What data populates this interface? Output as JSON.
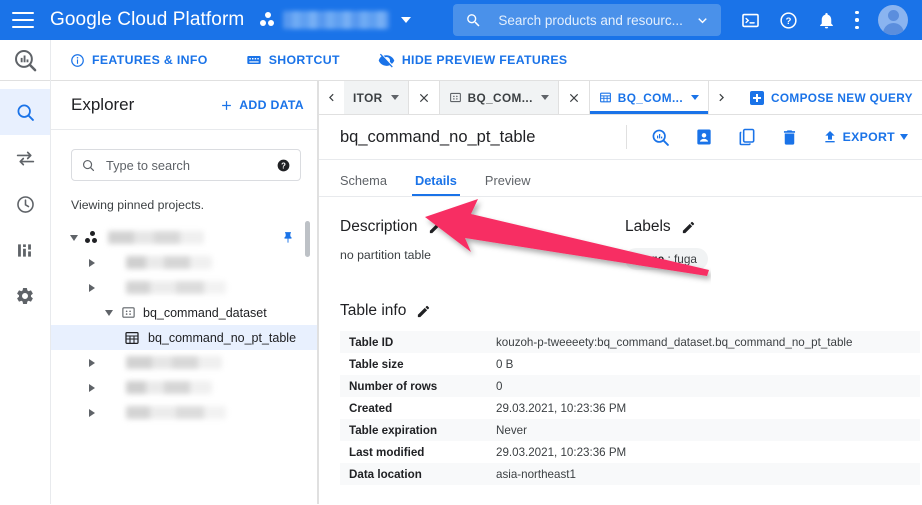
{
  "topbar": {
    "menu_icon": "hamburger-icon",
    "brand": "Google Cloud Platform",
    "project_icon": "project-dots-icon",
    "project_name_redacted": "",
    "search": {
      "icon": "search-icon",
      "placeholder": "Search products and resourc...",
      "dropdown_icon": "chevron-down-icon"
    },
    "actions": [
      {
        "name": "cloud-shell-icon",
        "label": ""
      },
      {
        "name": "help-icon",
        "label": ""
      },
      {
        "name": "notifications-icon",
        "label": ""
      },
      {
        "name": "more-options-icon",
        "label": ""
      },
      {
        "name": "avatar",
        "label": ""
      }
    ]
  },
  "featurebar": {
    "product_logo": "bigquery-logo-icon",
    "items": [
      {
        "icon": "info-icon",
        "label": "FEATURES & INFO"
      },
      {
        "icon": "keyboard-icon",
        "label": "SHORTCUT"
      },
      {
        "icon": "eye-off-icon",
        "label": "HIDE PREVIEW FEATURES"
      }
    ]
  },
  "rail": {
    "items": [
      {
        "name": "rail-search",
        "icon": "search-icon",
        "active": true
      },
      {
        "name": "rail-transfers",
        "icon": "transfer-arrows-icon",
        "active": false
      },
      {
        "name": "rail-history",
        "icon": "clock-icon",
        "active": false
      },
      {
        "name": "rail-analytics",
        "icon": "bar-chart-icon",
        "active": false
      },
      {
        "name": "rail-settings",
        "icon": "gear-icon",
        "active": false
      }
    ]
  },
  "explorer": {
    "title": "Explorer",
    "add_data": {
      "icon": "plus-icon",
      "label": "ADD DATA"
    },
    "search": {
      "icon": "search-icon",
      "placeholder": "Type to search",
      "help_icon": "help-filled-icon"
    },
    "status_text": "Viewing pinned projects.",
    "tree": [
      {
        "name": "tree-project-redacted",
        "label": "",
        "indent": 0,
        "expander": "down",
        "icon": "project-dots-icon",
        "redacted": true,
        "pinned": true,
        "pin_icon": "pin-icon"
      },
      {
        "name": "tree-dataset-redacted-1",
        "label": "",
        "indent": 1,
        "expander": "right",
        "icon": "",
        "redacted": true
      },
      {
        "name": "tree-dataset-redacted-2",
        "label": "",
        "indent": 1,
        "expander": "right",
        "icon": "",
        "redacted": true
      },
      {
        "name": "tree-dataset-bq-command-dataset",
        "label": "bq_command_dataset",
        "indent": 1,
        "expander": "down",
        "icon": "dataset-icon",
        "redacted": false
      },
      {
        "name": "tree-table-bq-command-no-pt-table",
        "label": "bq_command_no_pt_table",
        "indent": 2,
        "expander": "none",
        "icon": "table-icon",
        "redacted": false,
        "selected": true
      },
      {
        "name": "tree-dataset-redacted-3",
        "label": "",
        "indent": 1,
        "expander": "right",
        "icon": "",
        "redacted": true
      },
      {
        "name": "tree-dataset-redacted-4",
        "label": "",
        "indent": 1,
        "expander": "right",
        "icon": "",
        "redacted": true
      },
      {
        "name": "tree-dataset-redacted-5",
        "label": "",
        "indent": 1,
        "expander": "right",
        "icon": "",
        "redacted": true
      }
    ]
  },
  "tabs": {
    "prev_icon": "chevron-left-icon",
    "next_icon": "chevron-right-icon",
    "items": [
      {
        "name": "tab-editor",
        "label": "ITOR",
        "icon": "",
        "active": false,
        "closeable": true
      },
      {
        "name": "tab-dataset",
        "label": "BQ_COM...",
        "icon": "dataset-icon",
        "active": false,
        "closeable": true
      },
      {
        "name": "tab-table",
        "label": "BQ_COM...",
        "icon": "table-icon",
        "active": true,
        "closeable": false
      }
    ],
    "compose": {
      "icon": "plus-square-icon",
      "label": "COMPOSE NEW QUERY"
    }
  },
  "table_header": {
    "title": "bq_command_no_pt_table",
    "actions": [
      {
        "name": "query-table-button",
        "icon": "query-icon"
      },
      {
        "name": "share-table-button",
        "icon": "person-card-icon"
      },
      {
        "name": "copy-table-button",
        "icon": "copy-icon"
      },
      {
        "name": "delete-table-button",
        "icon": "trash-icon"
      }
    ],
    "export": {
      "icon": "upload-icon",
      "label": "EXPORT",
      "dropdown_icon": "chevron-down-icon"
    }
  },
  "subtabs": [
    {
      "name": "tab-schema",
      "label": "Schema",
      "active": false
    },
    {
      "name": "tab-details",
      "label": "Details",
      "active": true
    },
    {
      "name": "tab-preview",
      "label": "Preview",
      "active": false
    }
  ],
  "details": {
    "description": {
      "title": "Description",
      "edit_icon": "pencil-icon",
      "value": "no partition table"
    },
    "labels": {
      "title": "Labels",
      "edit_icon": "pencil-icon",
      "chip_key": "hoge",
      "chip_sep": " : ",
      "chip_value": "fuga"
    },
    "table_info": {
      "title": "Table info",
      "edit_icon": "pencil-icon",
      "rows": [
        {
          "key": "Table ID",
          "value": "kouzoh-p-tweeeety:bq_command_dataset.bq_command_no_pt_table"
        },
        {
          "key": "Table size",
          "value": "0 B"
        },
        {
          "key": "Number of rows",
          "value": "0"
        },
        {
          "key": "Created",
          "value": "29.03.2021, 10:23:36 PM"
        },
        {
          "key": "Table expiration",
          "value": "Never"
        },
        {
          "key": "Last modified",
          "value": "29.03.2021, 10:23:36 PM"
        },
        {
          "key": "Data location",
          "value": "asia-northeast1"
        }
      ]
    }
  },
  "annotation": {
    "name": "pink-arrow-annotation",
    "color": "#F72E63",
    "points_to": "no partition table"
  },
  "colors": {
    "brand_blue": "#1a73e8",
    "header_blue": "#1a73e8",
    "selected_row": "#e8f0fe",
    "annotation_pink": "#F72E63"
  }
}
